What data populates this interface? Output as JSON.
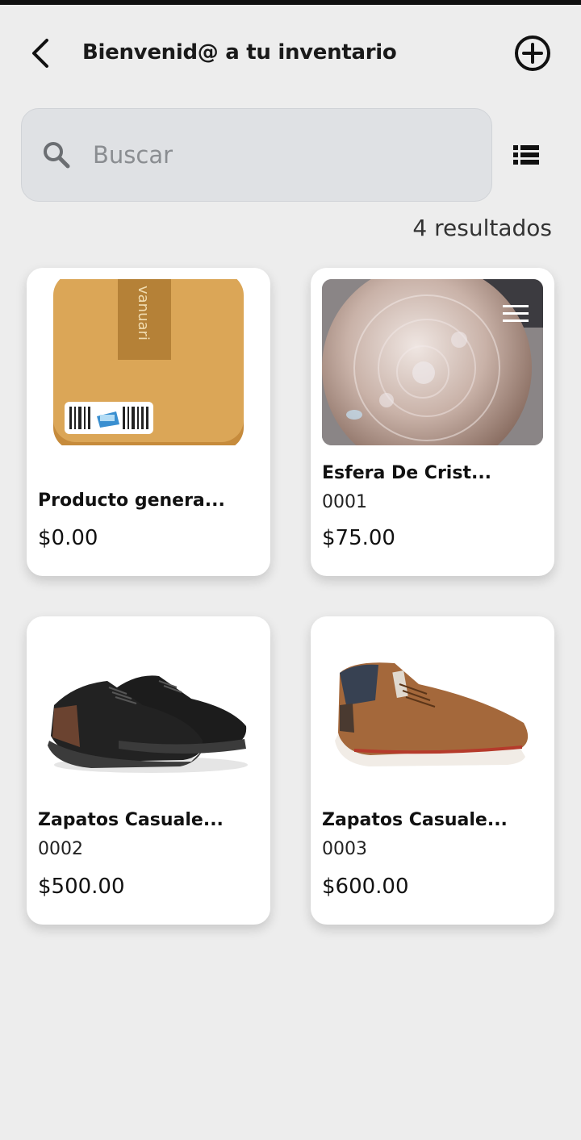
{
  "header": {
    "title": "Bienvenid@ a tu inventario"
  },
  "search": {
    "placeholder": "Buscar"
  },
  "results_label": "4 resultados",
  "products": [
    {
      "name": "Producto genera...",
      "code": "",
      "price": "$0.00",
      "image": "box-icon"
    },
    {
      "name": "Esfera De Crist...",
      "code": "0001",
      "price": "$75.00",
      "image": "crystal-sphere-photo"
    },
    {
      "name": "Zapatos Casuale...",
      "code": "0002",
      "price": "$500.00",
      "image": "black-shoes-photo"
    },
    {
      "name": "Zapatos Casuale...",
      "code": "0003",
      "price": "$600.00",
      "image": "brown-shoe-photo"
    }
  ],
  "icons": {
    "back": "chevron-left-icon",
    "add": "add-circle-icon",
    "search": "search-icon",
    "view": "list-view-icon"
  },
  "colors": {
    "background": "#ededed",
    "search_bg": "#dfe1e4",
    "card_bg": "#ffffff",
    "box": "#dba657"
  }
}
